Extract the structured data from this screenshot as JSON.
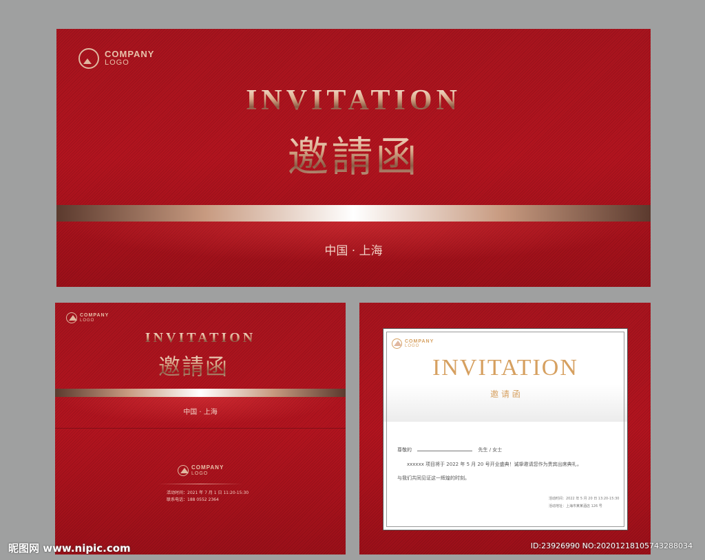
{
  "top_card": {
    "logo_line1": "COMPANY",
    "logo_line2": "LOGO",
    "title_en": "INVITATION",
    "title_cn": "邀請函",
    "city": "中国 · 上海"
  },
  "bottom_left_card": {
    "logo_line1": "COMPANY",
    "logo_line2": "LOGO",
    "title_en": "INVITATION",
    "title_cn": "邀請函",
    "city": "中国 · 上海",
    "footer_logo_line1": "COMPANY",
    "footer_logo_line2": "LOGO",
    "event_time": "活动时间：2021 年 7 月 1 日 11:20-15:30",
    "contact": "联系电话：188 0552 2364"
  },
  "bottom_right_card": {
    "logo_line1": "COMPANY",
    "logo_line2": "LOGO",
    "title_en": "INVITATION",
    "title_cn": "邀 请 函",
    "greeting_prefix": "尊敬的",
    "greeting_suffix": "先生 / 女士",
    "body_line1": "xxxxxx 项目将于 2022 年 5 月 20 号开业盛典！诚挚邀请您作为贵宾出席典礼，",
    "body_line2": "与我们共同见证这一辉煌的时刻。",
    "event_time": "活动时间：2022 年 5 月 20 日 13:20-15:30",
    "event_place": "活动地址：上海市某某酒店 126 号"
  },
  "watermark": {
    "left": "昵图网 www.nipic.com",
    "right": "ID:23926990 NO:20201218105743288034"
  },
  "colors": {
    "card_red": "#a8141e",
    "gold": "#d6a060",
    "background": "#9fa0a0"
  }
}
